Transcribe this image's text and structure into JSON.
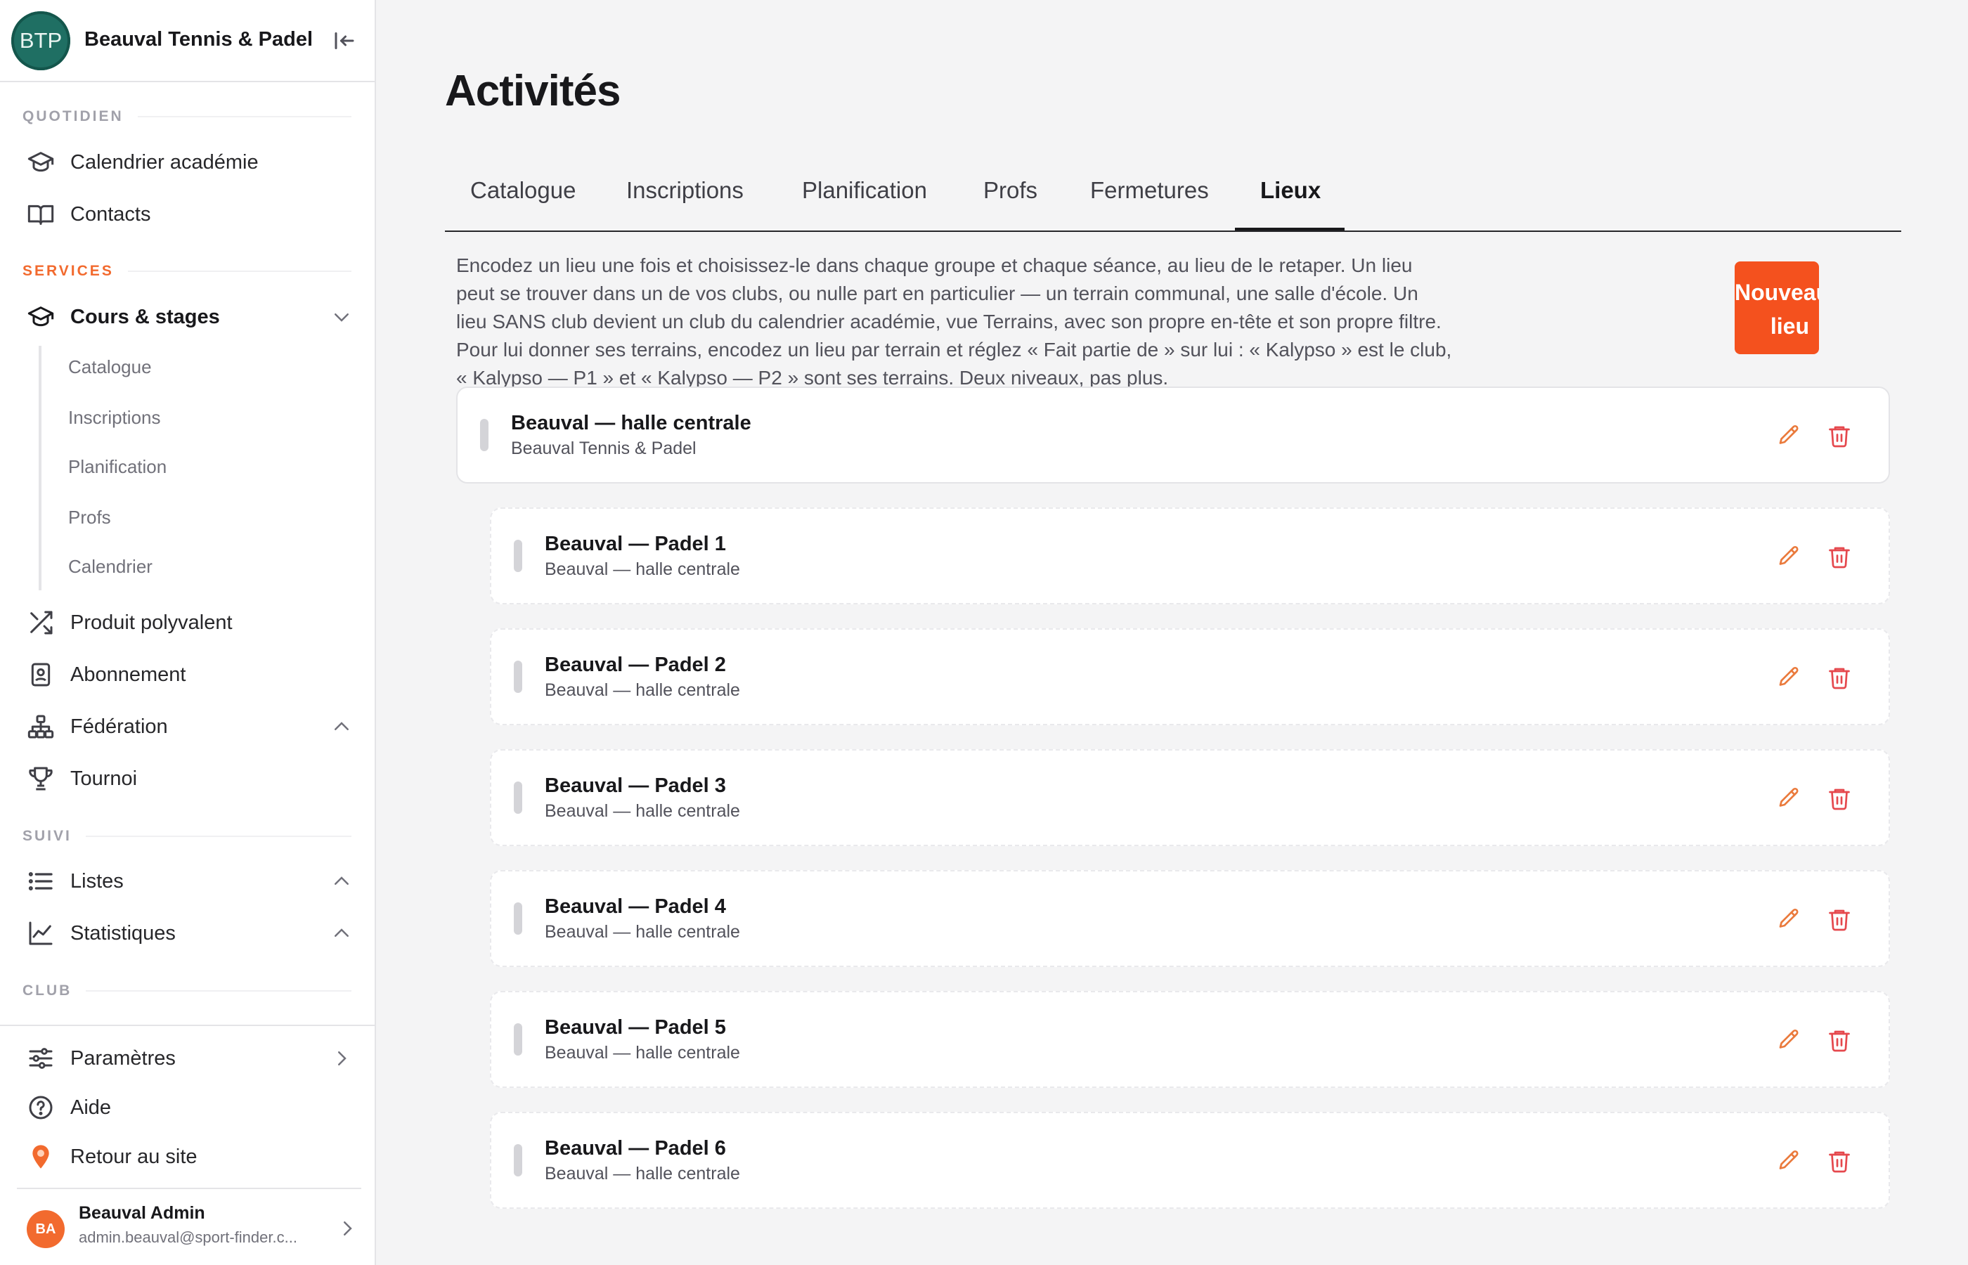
{
  "brand": {
    "initials": "BTP",
    "name": "Beauval Tennis & Padel"
  },
  "sidebar": {
    "sections": {
      "quotidien": "QUOTIDIEN",
      "services": "SERVICES",
      "suivi": "SUIVI",
      "club": "CLUB"
    },
    "items": {
      "calendrier_academie": "Calendrier académie",
      "contacts": "Contacts",
      "cours_stages": "Cours & stages",
      "produit_polyvalent": "Produit polyvalent",
      "abonnement": "Abonnement",
      "federation": "Fédération",
      "tournoi": "Tournoi",
      "listes": "Listes",
      "statistiques": "Statistiques",
      "parametres": "Paramètres",
      "aide": "Aide",
      "retour_site": "Retour au site"
    },
    "sub_items": [
      "Catalogue",
      "Inscriptions",
      "Planification",
      "Profs",
      "Calendrier"
    ]
  },
  "user": {
    "initials": "BA",
    "name": "Beauval Admin",
    "email": "admin.beauval@sport-finder.c..."
  },
  "main": {
    "title": "Activités",
    "tabs": [
      "Catalogue",
      "Inscriptions",
      "Planification",
      "Profs",
      "Fermetures",
      "Lieux"
    ],
    "active_tab": "Lieux",
    "intro": "Encodez un lieu une fois et choisissez-le dans chaque groupe et chaque séance, au lieu de le retaper. Un lieu peut se trouver dans un de vos clubs, ou nulle part en particulier — un terrain communal, une salle d'école. Un lieu SANS club devient un club du calendrier académie, vue Terrains, avec son propre en-tête et son propre filtre. Pour lui donner ses terrains, encodez un lieu par terrain et réglez « Fait partie de » sur lui : « Kalypso » est le club, « Kalypso — P1 » et « Kalypso — P2 » sont ses terrains. Deux niveaux, pas plus.",
    "new_button": "Nouveau lieu",
    "places": [
      {
        "name": "Beauval — halle centrale",
        "sub": "Beauval Tennis & Padel",
        "level": "parent"
      },
      {
        "name": "Beauval — Padel 1",
        "sub": "Beauval — halle centrale",
        "level": "child"
      },
      {
        "name": "Beauval — Padel 2",
        "sub": "Beauval — halle centrale",
        "level": "child"
      },
      {
        "name": "Beauval — Padel 3",
        "sub": "Beauval — halle centrale",
        "level": "child"
      },
      {
        "name": "Beauval — Padel 4",
        "sub": "Beauval — halle centrale",
        "level": "child"
      },
      {
        "name": "Beauval — Padel 5",
        "sub": "Beauval — halle centrale",
        "level": "child"
      },
      {
        "name": "Beauval — Padel 6",
        "sub": "Beauval — halle centrale",
        "level": "child"
      }
    ]
  },
  "colors": {
    "accent": "#f4511e",
    "brand_logo": "#1f6f63",
    "section_services": "#f26a2e",
    "edit_icon": "#ea7a3c",
    "delete_icon": "#e5484d"
  }
}
